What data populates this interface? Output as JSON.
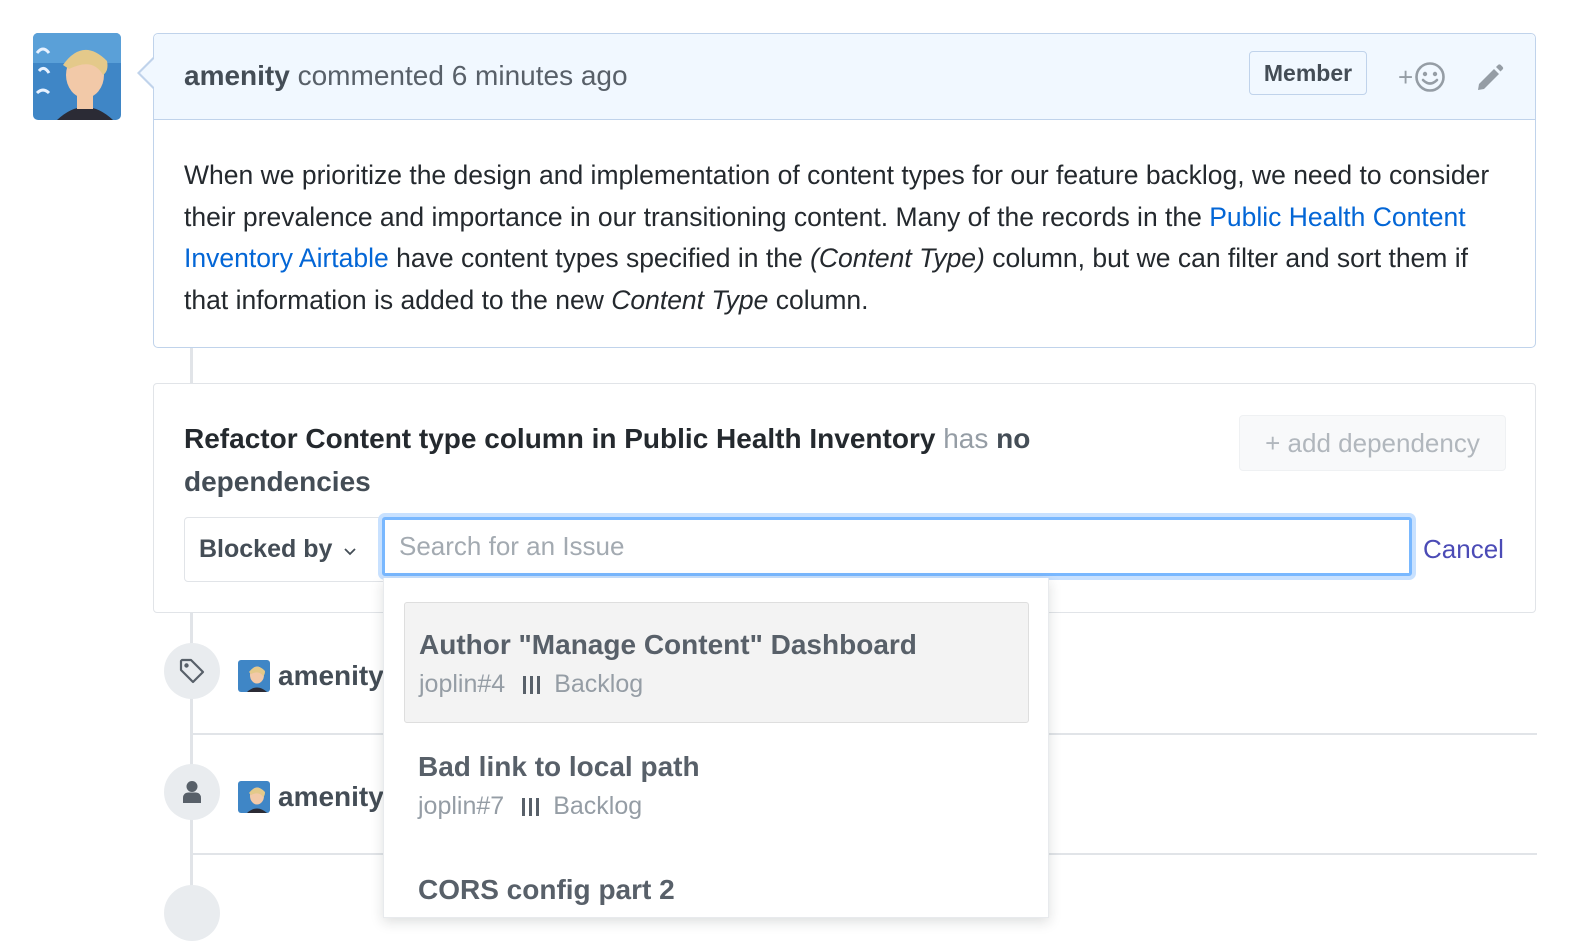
{
  "comment": {
    "author": "amenity",
    "action": "commented",
    "time": "6 minutes ago",
    "badge": "Member",
    "reaction_plus": "+",
    "body": {
      "p1": "When we prioritize the design and implementation of content types for our feature backlog, we need to consider their prevalence and importance in our transitioning content. Many of the records in the ",
      "link": "Public Health Content Inventory Airtable",
      "p2": " have content types specified in the ",
      "em1": "(Content Type)",
      "p3": " column, but we can filter and sort them if that information is added to the new ",
      "em2": "Content Type",
      "p4": " column."
    }
  },
  "dependencies": {
    "issue_title": "Refactor Content type column in Public Health Inventory",
    "has": "has",
    "no_dependencies": "no dependencies",
    "add_button": "+ add dependency",
    "relation_select": "Blocked by",
    "search_placeholder": "Search for an Issue",
    "search_value": "",
    "cancel": "Cancel"
  },
  "timeline": {
    "events": [
      {
        "icon": "tag-icon",
        "user": "amenity"
      },
      {
        "icon": "person-icon",
        "user": "amenity"
      }
    ]
  },
  "dropdown": {
    "items": [
      {
        "title": "Author \"Manage Content\" Dashboard",
        "ref": "joplin#4",
        "column": "Backlog",
        "active": true
      },
      {
        "title": "Bad link to local path",
        "ref": "joplin#7",
        "column": "Backlog",
        "active": false
      },
      {
        "title": "CORS config part 2",
        "ref": "",
        "column": "",
        "active": false
      }
    ]
  },
  "colors": {
    "link": "#0366d6",
    "header_bg": "#f1f8ff",
    "focus_ring": "#79b8ff",
    "cancel": "#4b4bb6"
  }
}
